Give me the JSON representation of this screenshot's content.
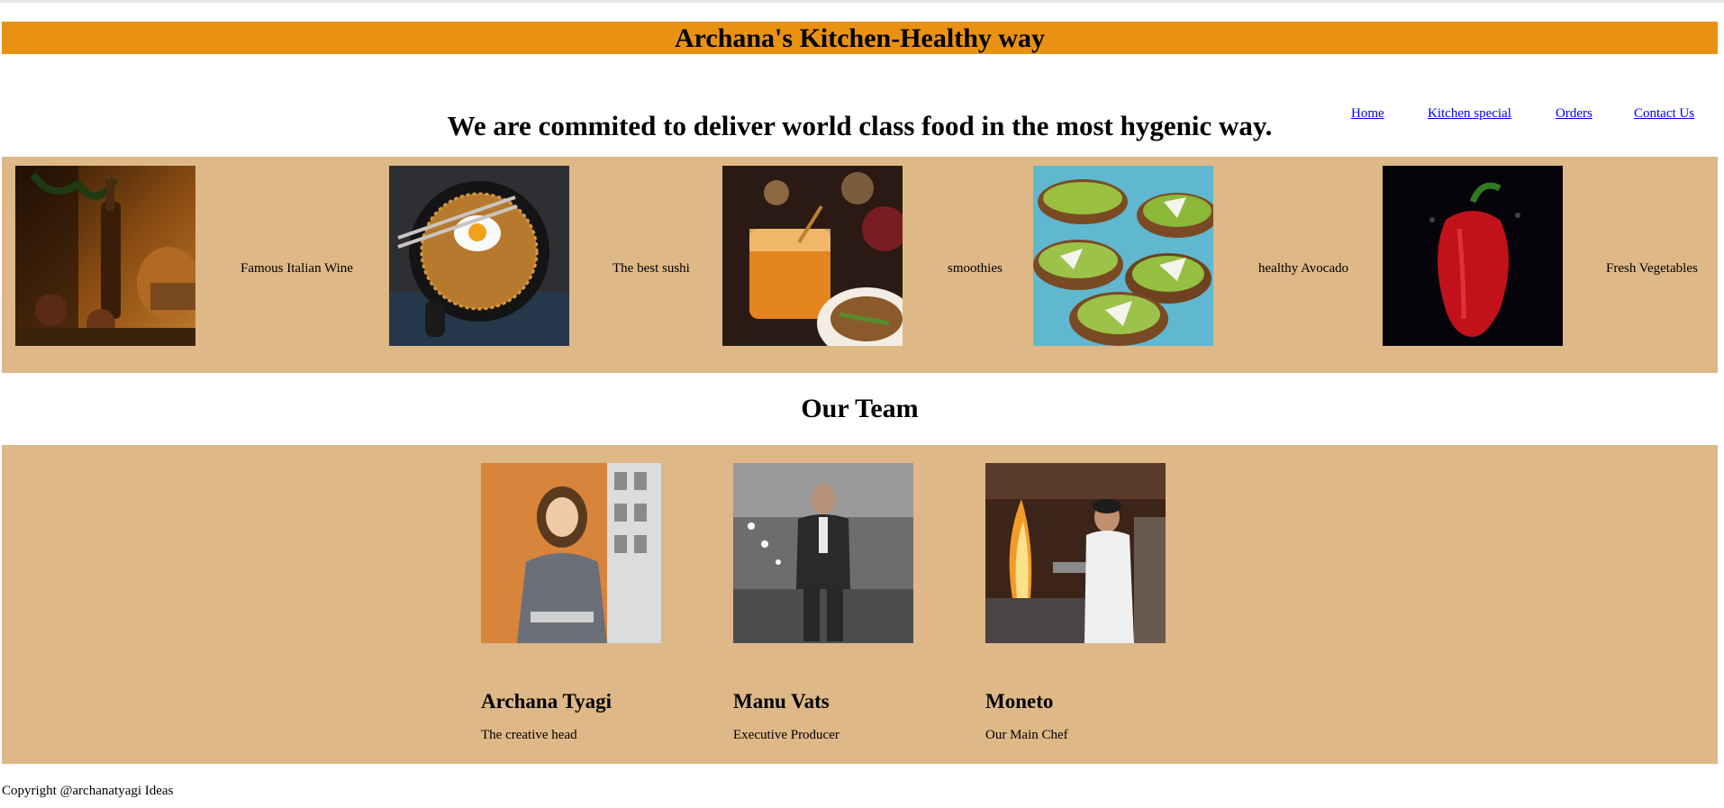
{
  "header": {
    "title": "Archana's Kitchen-Healthy way",
    "accent_color": "#e89112"
  },
  "nav": {
    "links": [
      {
        "label": "Home"
      },
      {
        "label": "Kitchen special"
      },
      {
        "label": "Orders"
      },
      {
        "label": "Contact Us"
      }
    ]
  },
  "tagline": "We are commited to deliver world class food in the most hygenic way.",
  "food_strip": {
    "background_color": "#deb887",
    "items": [
      {
        "caption": "Famous Italian Wine",
        "image": "wine-bottle-photo"
      },
      {
        "caption": "The best sushi",
        "image": "noodle-bowl-photo"
      },
      {
        "caption": "smoothies",
        "image": "orange-drink-photo"
      },
      {
        "caption": "healthy Avocado",
        "image": "avocado-toast-photo"
      },
      {
        "caption": "Fresh Vegetables",
        "image": "red-pepper-photo"
      }
    ]
  },
  "team": {
    "title": "Our Team",
    "members": [
      {
        "name": "Archana Tyagi",
        "role": "The creative head",
        "image": "woman-portrait-photo"
      },
      {
        "name": "Manu Vats",
        "role": "Executive Producer",
        "image": "man-in-suit-photo"
      },
      {
        "name": "Moneto",
        "role": "Our Main Chef",
        "image": "chef-cooking-photo"
      }
    ]
  },
  "footer": {
    "copyright": "Copyright @archanatyagi Ideas"
  }
}
